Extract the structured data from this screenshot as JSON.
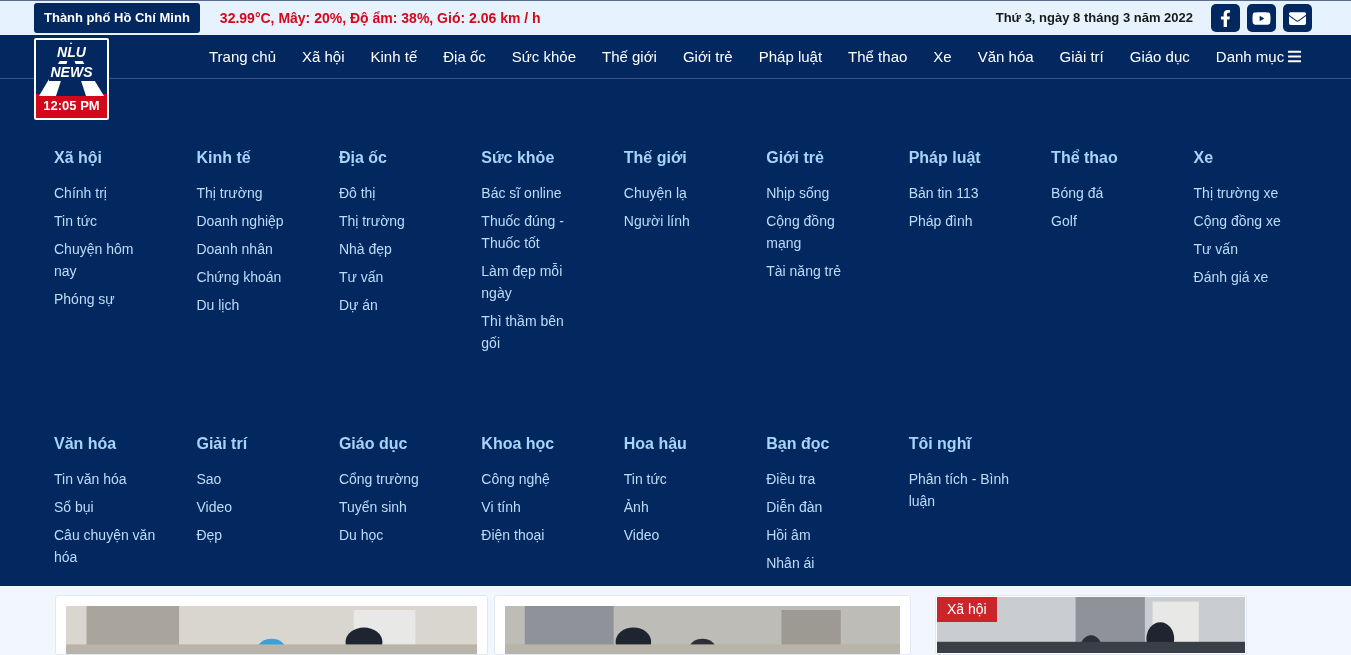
{
  "top_bar": {
    "location": "Thành phố Hồ Chí Minh",
    "weather": "32.99°C, Mây: 20%, Độ ẩm: 38%, Gió: 2.06 km / h",
    "date": "Thứ 3, ngày 8 tháng 3 năm 2022"
  },
  "logo": {
    "line_1": "NLU",
    "line_2": "NEWS",
    "time": "12:05 PM"
  },
  "nav": [
    {
      "label": "Trang chủ"
    },
    {
      "label": "Xã hội"
    },
    {
      "label": "Kinh tế"
    },
    {
      "label": "Địa ốc"
    },
    {
      "label": "Sức khỏe"
    },
    {
      "label": "Thế giới"
    },
    {
      "label": "Giới trẻ"
    },
    {
      "label": "Pháp luật"
    },
    {
      "label": "Thể thao"
    },
    {
      "label": "Xe"
    },
    {
      "label": "Văn hóa"
    },
    {
      "label": "Giải trí"
    },
    {
      "label": "Giáo dục"
    },
    {
      "label": "Danh mục",
      "kind": "menu"
    }
  ],
  "mega_menu": [
    {
      "heading": "Xã hội",
      "items": [
        "Chính trị",
        "Tin tức",
        "Chuyện hôm nay",
        "Phóng sự"
      ]
    },
    {
      "heading": "Kinh tế",
      "items": [
        "Thị trường",
        "Doanh nghiệp",
        "Doanh nhân",
        "Chứng khoán",
        "Du lịch"
      ]
    },
    {
      "heading": "Địa ốc",
      "items": [
        "Đô thị",
        "Thị trường",
        "Nhà đẹp",
        "Tư vấn",
        "Dự án"
      ]
    },
    {
      "heading": "Sức khỏe",
      "items": [
        "Bác sĩ online",
        "Thuốc đúng - Thuốc tốt",
        "Làm đẹp mỗi ngày",
        "Thì thầm bên gối"
      ]
    },
    {
      "heading": "Thế giới",
      "items": [
        "Chuyện lạ",
        "Người lính"
      ]
    },
    {
      "heading": "Giới trẻ",
      "items": [
        "Nhịp sống",
        "Cộng đồng mạng",
        "Tài năng trẻ"
      ]
    },
    {
      "heading": "Pháp luật",
      "items": [
        "Bản tin 113",
        "Pháp đình"
      ]
    },
    {
      "heading": "Thể thao",
      "items": [
        "Bóng đá",
        "Golf"
      ]
    },
    {
      "heading": "Xe",
      "items": [
        "Thị trường xe",
        "Cộng đồng xe",
        "Tư vấn",
        "Đánh giá xe"
      ]
    },
    {
      "heading": "Văn hóa",
      "items": [
        "Tin văn hóa",
        "Sổ bụi",
        "Câu chuyện văn hóa"
      ]
    },
    {
      "heading": "Giải trí",
      "items": [
        "Sao",
        "Video",
        "Đẹp"
      ]
    },
    {
      "heading": "Giáo dục",
      "items": [
        "Cổng trường",
        "Tuyển sinh",
        "Du học"
      ]
    },
    {
      "heading": "Khoa học",
      "items": [
        "Công nghệ",
        "Vi tính",
        "Điện thoại"
      ]
    },
    {
      "heading": "Hoa hậu",
      "items": [
        "Tin tức",
        "Ảnh",
        "Video"
      ]
    },
    {
      "heading": "Bạn đọc",
      "items": [
        "Điều tra",
        "Diễn đàn",
        "Hồi âm",
        "Nhân ái"
      ]
    },
    {
      "heading": "Tôi nghĩ",
      "items": [
        "Phân tích - Bình luận"
      ]
    }
  ],
  "cards": [
    {
      "kind": "picture"
    },
    {
      "kind": "picture"
    },
    {
      "kind": "picture",
      "tag": "Xã hội"
    }
  ]
}
